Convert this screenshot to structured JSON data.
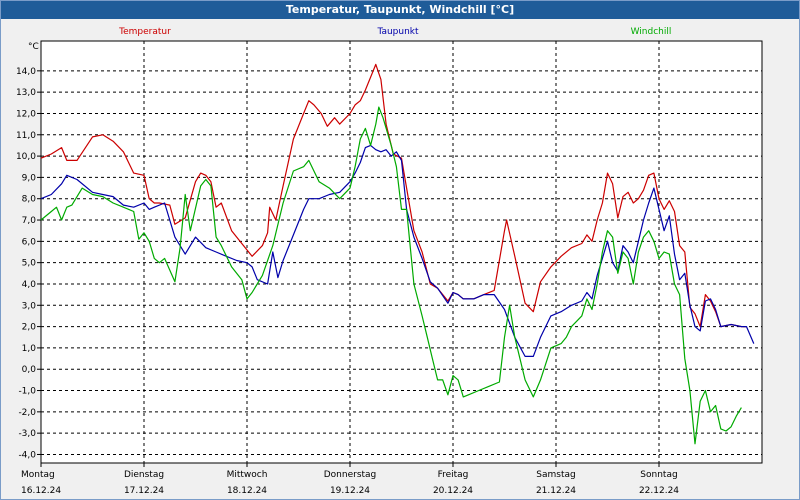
{
  "window": {
    "title": "Temperatur, Taupunkt, Windchill [°C]"
  },
  "chart_data": {
    "type": "line",
    "title": "Temperatur, Taupunkt, Windchill [°C]",
    "ylabel": "°C",
    "ylim": [
      -4.4,
      15.4
    ],
    "xlim": [
      0,
      7.1
    ],
    "grid": true,
    "legend_placement": "top",
    "y_ticks": [
      "14,0",
      "13,0",
      "12,0",
      "11,0",
      "10,0",
      "9,0",
      "8,0",
      "7,0",
      "6,0",
      "5,0",
      "4,0",
      "3,0",
      "2,0",
      "1,0",
      "0,0",
      "-1,0",
      "-2,0",
      "-3,0",
      "-4,0"
    ],
    "x_ticks": [
      {
        "day": "Montag",
        "date": "16.12.24"
      },
      {
        "day": "Dienstag",
        "date": "17.12.24"
      },
      {
        "day": "Mittwoch",
        "date": "18.12.24"
      },
      {
        "day": "Donnerstag",
        "date": "19.12.24"
      },
      {
        "day": "Freitag",
        "date": "20.12.24"
      },
      {
        "day": "Samstag",
        "date": "21.12.24"
      },
      {
        "day": "Sonntag",
        "date": "22.12.24"
      }
    ],
    "series": [
      {
        "name": "Temperatur",
        "color": "#cc0000",
        "points": [
          [
            0,
            9.9
          ],
          [
            0.1,
            10.1
          ],
          [
            0.2,
            10.4
          ],
          [
            0.25,
            9.8
          ],
          [
            0.35,
            9.8
          ],
          [
            0.5,
            10.9
          ],
          [
            0.6,
            11.0
          ],
          [
            0.7,
            10.7
          ],
          [
            0.8,
            10.2
          ],
          [
            0.9,
            9.2
          ],
          [
            1.0,
            9.1
          ],
          [
            1.05,
            8.0
          ],
          [
            1.1,
            7.8
          ],
          [
            1.15,
            7.8
          ],
          [
            1.25,
            7.7
          ],
          [
            1.3,
            6.8
          ],
          [
            1.4,
            7.1
          ],
          [
            1.5,
            8.8
          ],
          [
            1.55,
            9.2
          ],
          [
            1.6,
            9.1
          ],
          [
            1.65,
            8.8
          ],
          [
            1.7,
            7.6
          ],
          [
            1.75,
            7.8
          ],
          [
            1.85,
            6.5
          ],
          [
            1.95,
            5.9
          ],
          [
            2.05,
            5.3
          ],
          [
            2.15,
            5.8
          ],
          [
            2.2,
            6.4
          ],
          [
            2.22,
            7.6
          ],
          [
            2.28,
            7.0
          ],
          [
            2.35,
            8.6
          ],
          [
            2.45,
            10.8
          ],
          [
            2.55,
            12.0
          ],
          [
            2.6,
            12.6
          ],
          [
            2.65,
            12.4
          ],
          [
            2.72,
            12.0
          ],
          [
            2.78,
            11.4
          ],
          [
            2.85,
            11.8
          ],
          [
            2.9,
            11.5
          ],
          [
            3.0,
            12.0
          ],
          [
            3.05,
            12.4
          ],
          [
            3.1,
            12.6
          ],
          [
            3.15,
            13.1
          ],
          [
            3.25,
            14.3
          ],
          [
            3.3,
            13.6
          ],
          [
            3.35,
            11.5
          ],
          [
            3.42,
            10.1
          ],
          [
            3.5,
            9.9
          ],
          [
            3.55,
            8.5
          ],
          [
            3.62,
            6.5
          ],
          [
            3.7,
            5.5
          ],
          [
            3.78,
            4.0
          ],
          [
            3.85,
            3.8
          ],
          [
            3.95,
            3.2
          ],
          [
            4.0,
            3.6
          ],
          [
            4.05,
            3.5
          ],
          [
            4.1,
            3.3
          ],
          [
            4.2,
            3.3
          ],
          [
            4.3,
            3.5
          ],
          [
            4.4,
            3.7
          ],
          [
            4.5,
            6.5
          ],
          [
            4.52,
            7.0
          ],
          [
            4.6,
            5.3
          ],
          [
            4.7,
            3.1
          ],
          [
            4.78,
            2.7
          ],
          [
            4.85,
            4.1
          ],
          [
            4.95,
            4.8
          ],
          [
            5.05,
            5.3
          ],
          [
            5.15,
            5.7
          ],
          [
            5.25,
            5.9
          ],
          [
            5.3,
            6.3
          ],
          [
            5.35,
            6.0
          ],
          [
            5.4,
            7.0
          ],
          [
            5.45,
            7.8
          ],
          [
            5.5,
            9.2
          ],
          [
            5.55,
            8.7
          ],
          [
            5.6,
            7.1
          ],
          [
            5.65,
            8.1
          ],
          [
            5.7,
            8.3
          ],
          [
            5.75,
            7.8
          ],
          [
            5.8,
            8.0
          ],
          [
            5.85,
            8.4
          ],
          [
            5.9,
            9.1
          ],
          [
            5.95,
            9.2
          ],
          [
            6.0,
            8.0
          ],
          [
            6.05,
            7.5
          ],
          [
            6.1,
            7.9
          ],
          [
            6.15,
            7.4
          ],
          [
            6.2,
            5.8
          ],
          [
            6.25,
            5.5
          ],
          [
            6.3,
            2.9
          ],
          [
            6.35,
            2.6
          ],
          [
            6.4,
            2.0
          ],
          [
            6.45,
            3.5
          ],
          [
            6.5,
            3.2
          ],
          [
            6.55,
            2.7
          ],
          [
            6.6,
            2.0
          ],
          [
            6.7,
            2.1
          ],
          [
            6.8,
            2.0
          ],
          [
            6.85,
            2.0
          ]
        ]
      },
      {
        "name": "Taupunkt",
        "color": "#0000aa",
        "points": [
          [
            0,
            8.0
          ],
          [
            0.1,
            8.2
          ],
          [
            0.2,
            8.7
          ],
          [
            0.25,
            9.1
          ],
          [
            0.35,
            8.9
          ],
          [
            0.5,
            8.3
          ],
          [
            0.6,
            8.2
          ],
          [
            0.7,
            8.1
          ],
          [
            0.8,
            7.7
          ],
          [
            0.9,
            7.6
          ],
          [
            1.0,
            7.8
          ],
          [
            1.05,
            7.5
          ],
          [
            1.1,
            7.6
          ],
          [
            1.2,
            7.8
          ],
          [
            1.3,
            6.2
          ],
          [
            1.4,
            5.4
          ],
          [
            1.5,
            6.2
          ],
          [
            1.6,
            5.7
          ],
          [
            1.7,
            5.5
          ],
          [
            1.8,
            5.3
          ],
          [
            1.9,
            5.1
          ],
          [
            2.0,
            5.0
          ],
          [
            2.05,
            4.8
          ],
          [
            2.1,
            4.2
          ],
          [
            2.2,
            4.0
          ],
          [
            2.25,
            5.5
          ],
          [
            2.3,
            4.3
          ],
          [
            2.35,
            5.1
          ],
          [
            2.45,
            6.3
          ],
          [
            2.55,
            7.5
          ],
          [
            2.6,
            8.0
          ],
          [
            2.7,
            8.0
          ],
          [
            2.8,
            8.2
          ],
          [
            2.9,
            8.3
          ],
          [
            3.0,
            8.8
          ],
          [
            3.05,
            9.2
          ],
          [
            3.1,
            9.7
          ],
          [
            3.15,
            10.4
          ],
          [
            3.2,
            10.5
          ],
          [
            3.25,
            10.3
          ],
          [
            3.3,
            10.2
          ],
          [
            3.35,
            10.3
          ],
          [
            3.4,
            10.0
          ],
          [
            3.45,
            10.2
          ],
          [
            3.5,
            9.8
          ],
          [
            3.55,
            7.5
          ],
          [
            3.62,
            6.2
          ],
          [
            3.7,
            5.2
          ],
          [
            3.78,
            4.1
          ],
          [
            3.85,
            3.8
          ],
          [
            3.95,
            3.1
          ],
          [
            4.0,
            3.6
          ],
          [
            4.05,
            3.5
          ],
          [
            4.1,
            3.3
          ],
          [
            4.2,
            3.3
          ],
          [
            4.3,
            3.5
          ],
          [
            4.4,
            3.5
          ],
          [
            4.5,
            2.8
          ],
          [
            4.6,
            1.5
          ],
          [
            4.7,
            0.6
          ],
          [
            4.78,
            0.6
          ],
          [
            4.85,
            1.5
          ],
          [
            4.95,
            2.5
          ],
          [
            5.05,
            2.7
          ],
          [
            5.15,
            3.0
          ],
          [
            5.25,
            3.2
          ],
          [
            5.3,
            3.6
          ],
          [
            5.35,
            3.3
          ],
          [
            5.4,
            4.4
          ],
          [
            5.45,
            5.2
          ],
          [
            5.5,
            6.0
          ],
          [
            5.55,
            5.0
          ],
          [
            5.6,
            4.6
          ],
          [
            5.65,
            5.8
          ],
          [
            5.7,
            5.5
          ],
          [
            5.75,
            5.0
          ],
          [
            5.8,
            6.0
          ],
          [
            5.85,
            7.0
          ],
          [
            5.9,
            7.8
          ],
          [
            5.95,
            8.5
          ],
          [
            6.0,
            7.5
          ],
          [
            6.05,
            6.5
          ],
          [
            6.1,
            7.2
          ],
          [
            6.15,
            5.4
          ],
          [
            6.2,
            4.2
          ],
          [
            6.25,
            4.5
          ],
          [
            6.3,
            3.0
          ],
          [
            6.35,
            2.0
          ],
          [
            6.4,
            1.8
          ],
          [
            6.45,
            3.2
          ],
          [
            6.5,
            3.3
          ],
          [
            6.55,
            2.8
          ],
          [
            6.6,
            2.0
          ],
          [
            6.7,
            2.1
          ],
          [
            6.8,
            2.0
          ],
          [
            6.85,
            2.0
          ],
          [
            6.92,
            1.2
          ]
        ]
      },
      {
        "name": "Windchill",
        "color": "#00aa00",
        "points": [
          [
            0,
            7.0
          ],
          [
            0.1,
            7.4
          ],
          [
            0.15,
            7.6
          ],
          [
            0.2,
            7.0
          ],
          [
            0.25,
            7.6
          ],
          [
            0.3,
            7.7
          ],
          [
            0.4,
            8.5
          ],
          [
            0.5,
            8.2
          ],
          [
            0.6,
            8.1
          ],
          [
            0.7,
            7.8
          ],
          [
            0.8,
            7.6
          ],
          [
            0.9,
            7.4
          ],
          [
            0.95,
            6.1
          ],
          [
            1.0,
            6.4
          ],
          [
            1.05,
            6.0
          ],
          [
            1.1,
            5.2
          ],
          [
            1.15,
            5.0
          ],
          [
            1.2,
            5.2
          ],
          [
            1.3,
            4.1
          ],
          [
            1.35,
            5.7
          ],
          [
            1.4,
            8.2
          ],
          [
            1.45,
            6.5
          ],
          [
            1.55,
            8.6
          ],
          [
            1.6,
            8.9
          ],
          [
            1.65,
            8.6
          ],
          [
            1.7,
            6.2
          ],
          [
            1.75,
            5.8
          ],
          [
            1.85,
            4.8
          ],
          [
            1.95,
            4.2
          ],
          [
            2.0,
            3.3
          ],
          [
            2.05,
            3.6
          ],
          [
            2.15,
            4.4
          ],
          [
            2.25,
            5.8
          ],
          [
            2.35,
            7.8
          ],
          [
            2.45,
            9.3
          ],
          [
            2.55,
            9.5
          ],
          [
            2.6,
            9.8
          ],
          [
            2.7,
            8.8
          ],
          [
            2.8,
            8.5
          ],
          [
            2.9,
            8.0
          ],
          [
            3.0,
            8.5
          ],
          [
            3.05,
            9.5
          ],
          [
            3.1,
            10.8
          ],
          [
            3.15,
            11.3
          ],
          [
            3.2,
            10.5
          ],
          [
            3.25,
            11.5
          ],
          [
            3.28,
            12.3
          ],
          [
            3.32,
            11.8
          ],
          [
            3.4,
            10.5
          ],
          [
            3.45,
            9.5
          ],
          [
            3.5,
            7.5
          ],
          [
            3.55,
            7.5
          ],
          [
            3.58,
            6.0
          ],
          [
            3.62,
            4.0
          ],
          [
            3.7,
            2.5
          ],
          [
            3.75,
            1.5
          ],
          [
            3.8,
            0.5
          ],
          [
            3.85,
            -0.5
          ],
          [
            3.9,
            -0.5
          ],
          [
            3.95,
            -1.2
          ],
          [
            4.0,
            -0.3
          ],
          [
            4.05,
            -0.5
          ],
          [
            4.1,
            -1.3
          ],
          [
            4.15,
            -1.2
          ],
          [
            4.25,
            -1.0
          ],
          [
            4.35,
            -0.8
          ],
          [
            4.45,
            -0.6
          ],
          [
            4.5,
            1.5
          ],
          [
            4.55,
            3.0
          ],
          [
            4.6,
            1.5
          ],
          [
            4.7,
            -0.5
          ],
          [
            4.78,
            -1.3
          ],
          [
            4.85,
            -0.5
          ],
          [
            4.95,
            1.0
          ],
          [
            5.05,
            1.2
          ],
          [
            5.1,
            1.5
          ],
          [
            5.15,
            2.0
          ],
          [
            5.25,
            2.5
          ],
          [
            5.3,
            3.3
          ],
          [
            5.35,
            2.8
          ],
          [
            5.4,
            4.0
          ],
          [
            5.45,
            5.5
          ],
          [
            5.5,
            6.5
          ],
          [
            5.55,
            6.2
          ],
          [
            5.6,
            4.5
          ],
          [
            5.65,
            5.5
          ],
          [
            5.7,
            5.2
          ],
          [
            5.75,
            4.0
          ],
          [
            5.8,
            5.5
          ],
          [
            5.85,
            6.2
          ],
          [
            5.9,
            6.5
          ],
          [
            5.95,
            6.0
          ],
          [
            6.0,
            5.2
          ],
          [
            6.05,
            5.5
          ],
          [
            6.1,
            5.4
          ],
          [
            6.15,
            4.0
          ],
          [
            6.2,
            3.5
          ],
          [
            6.25,
            0.5
          ],
          [
            6.3,
            -1.0
          ],
          [
            6.35,
            -3.5
          ],
          [
            6.4,
            -1.5
          ],
          [
            6.45,
            -1.0
          ],
          [
            6.5,
            -2.0
          ],
          [
            6.55,
            -1.7
          ],
          [
            6.6,
            -2.8
          ],
          [
            6.65,
            -2.9
          ],
          [
            6.7,
            -2.7
          ],
          [
            6.75,
            -2.2
          ],
          [
            6.8,
            -1.8
          ]
        ]
      }
    ]
  }
}
